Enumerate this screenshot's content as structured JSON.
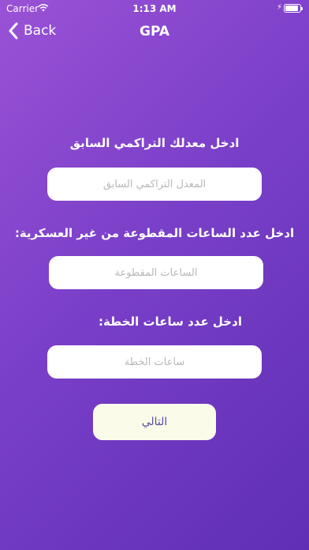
{
  "status_bar": {
    "carrier": "Carrier",
    "time": "1:13 AM",
    "battery_level": 0.9
  },
  "nav": {
    "back_label": "Back",
    "title": "GPA"
  },
  "form": {
    "gpa_prompt": "ادخل معدلك التراكمي السابق",
    "gpa_placeholder": "المعدل التراكمي السابق",
    "hours_prompt": "ادخل عدد الساعات المقطوعة من غير العسكرية:",
    "hours_placeholder": "الساعات المقطوعة",
    "plan_prompt": "ادخل عدد ساعات الخطة:",
    "plan_placeholder": "ساعات الخطة",
    "next_label": "التالي"
  },
  "colors": {
    "gradient_start": "#9a52d6",
    "gradient_end": "#5e2fb4",
    "button_bg": "#fbfbe9"
  }
}
